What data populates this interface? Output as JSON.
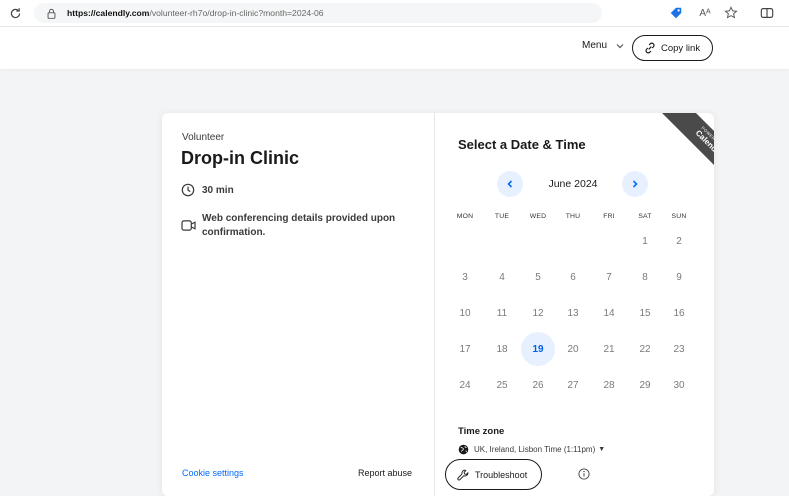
{
  "browser": {
    "url_domain": "https://calendly.com",
    "url_path": "/volunteer-rh7o/drop-in-clinic?month=2024-06",
    "reader_label": "Aᴬ"
  },
  "header": {
    "menu_label": "Menu",
    "copy_link_label": "Copy link"
  },
  "event": {
    "host": "Volunteer",
    "title": "Drop-in Clinic",
    "duration": "30 min",
    "conferencing": "Web conferencing details provided upon confirmation."
  },
  "footer": {
    "cookie_settings": "Cookie settings",
    "report_abuse": "Report abuse"
  },
  "scheduler": {
    "title": "Select a Date & Time",
    "month_label": "June 2024",
    "weekdays": [
      "MON",
      "TUE",
      "WED",
      "THU",
      "FRI",
      "SAT",
      "SUN"
    ],
    "first_weekday_index": 5,
    "days_in_month": 30,
    "available_days": [
      19
    ],
    "timezone_label": "Time zone",
    "timezone_value": "UK, Ireland, Lisbon Time (1:11pm)",
    "troubleshoot_label": "Troubleshoot"
  },
  "badge": {
    "small_text": "POWERED BY",
    "brand": "Calendly"
  },
  "colors": {
    "accent": "#006bff",
    "accent_light": "#e6f0ff",
    "ribbon": "#4a4a4a",
    "background": "#f3f4f6"
  },
  "icons": {
    "reload": "reload-icon",
    "lock": "lock-icon",
    "extension": "tag-icon",
    "favorite": "star-icon",
    "sidebar": "split-screen-icon",
    "menu_chevron": "chevron-down-icon",
    "copy_link": "link-icon",
    "duration": "clock-icon",
    "conferencing": "video-camera-icon",
    "prev_month": "chevron-left-icon",
    "next_month": "chevron-right-icon",
    "timezone": "globe-icon",
    "troubleshoot": "wrench-icon",
    "info": "info-icon"
  }
}
